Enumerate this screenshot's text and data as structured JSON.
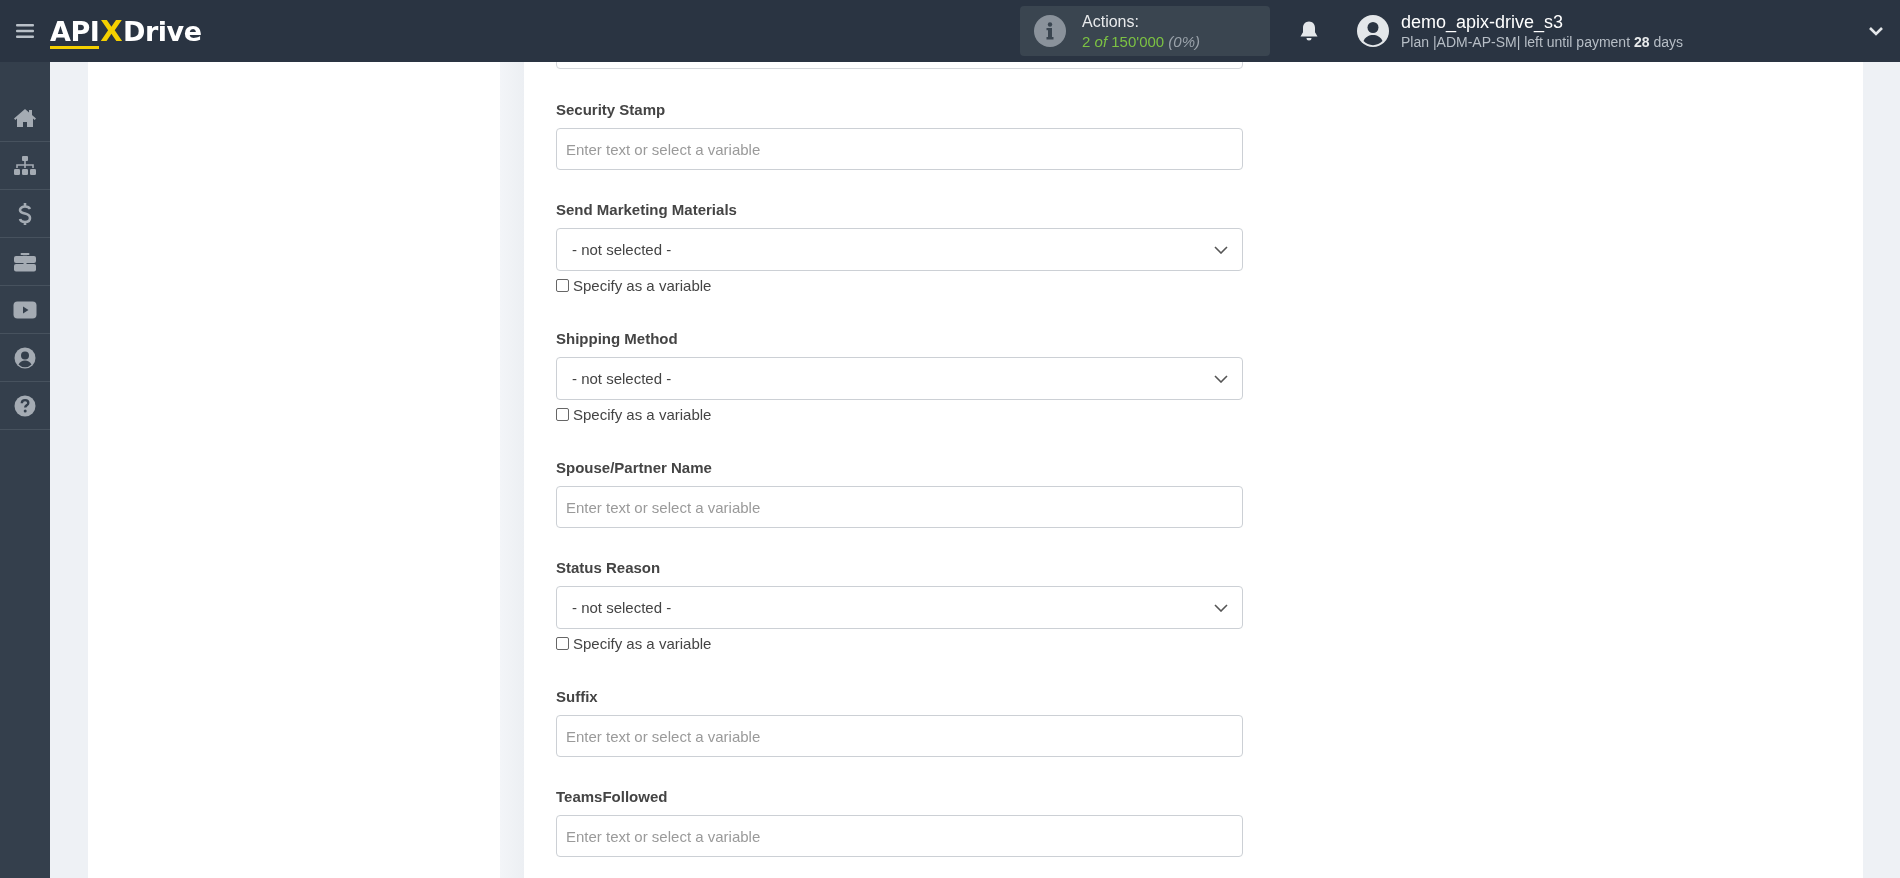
{
  "header": {
    "logo": [
      "API",
      "X",
      "Drive"
    ],
    "actions": {
      "label": "Actions:",
      "used": "2",
      "of": "of",
      "total": "150'000",
      "percent": "(0%)"
    },
    "user": {
      "name": "demo_apix-drive_s3",
      "plan": "Plan |ADM-AP-SM| left until payment **28** days"
    }
  },
  "fields": [
    {
      "kind": "input",
      "label": "Security Stamp",
      "placeholder": "Enter text or select a variable"
    },
    {
      "kind": "select",
      "label": "Send Marketing Materials",
      "value": "- not selected -",
      "variable": {
        "label": "Specify as a variable",
        "checked": false
      }
    },
    {
      "kind": "select",
      "label": "Shipping Method",
      "value": "- not selected -",
      "variable": {
        "label": "Specify as a variable",
        "checked": false
      }
    },
    {
      "kind": "input",
      "label": "Spouse/Partner Name",
      "placeholder": "Enter text or select a variable"
    },
    {
      "kind": "select",
      "label": "Status Reason",
      "value": "- not selected -",
      "variable": {
        "label": "Specify as a variable",
        "checked": false
      }
    },
    {
      "kind": "input",
      "label": "Suffix",
      "placeholder": "Enter text or select a variable"
    },
    {
      "kind": "input",
      "label": "TeamsFollowed",
      "placeholder": "Enter text or select a variable"
    }
  ]
}
